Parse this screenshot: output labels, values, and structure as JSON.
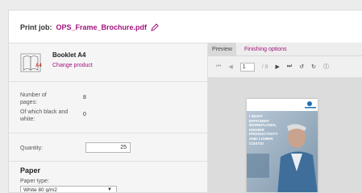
{
  "print_job": {
    "label": "Print job:",
    "filename": "OPS_Frame_Brochure.pdf",
    "edit_icon": "pencil-icon"
  },
  "product": {
    "icon": "booklet-icon",
    "badge": "A4",
    "name": "Booklet A4",
    "change_label": "Change product"
  },
  "pages": {
    "count_label": "Number of pages:",
    "count_value": "8",
    "bw_label": "Of which black and white:",
    "bw_value": "0"
  },
  "quantity": {
    "label": "Quantity:",
    "value": "25"
  },
  "paper": {
    "heading": "Paper",
    "type_label": "Paper type:",
    "type_value": "White 80 g/m2"
  },
  "preview": {
    "tabs": [
      "Preview",
      "Finishing options"
    ],
    "active_tab": "Preview",
    "page_current": "1",
    "page_total": "/ 8",
    "brochure_text": "I WANT EFFICIENT WORKFLOWS, HIGHER PRODUCTIVITY AND LOWER COSTS!"
  },
  "colors": {
    "accent": "#a0137c",
    "brochure_blue": "#1e6fb8"
  }
}
